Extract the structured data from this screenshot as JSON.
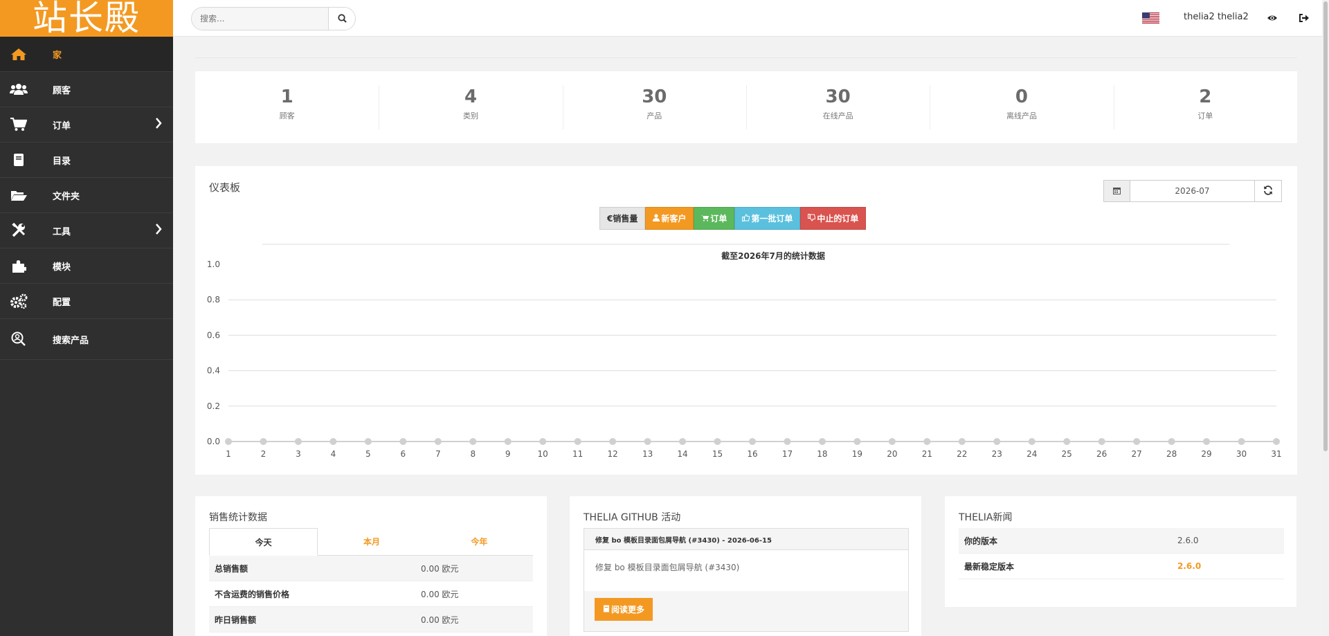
{
  "logo": {
    "text": "站长殿"
  },
  "nav": [
    {
      "label": "家",
      "icon": "home-icon",
      "active": true
    },
    {
      "label": "顾客",
      "icon": "users-icon"
    },
    {
      "label": "订单",
      "icon": "cart-icon",
      "has_submenu": true
    },
    {
      "label": "目录",
      "icon": "book-icon"
    },
    {
      "label": "文件夹",
      "icon": "folder-icon"
    },
    {
      "label": "工具",
      "icon": "tools-icon",
      "has_submenu": true
    },
    {
      "label": "模块",
      "icon": "puzzle-icon"
    },
    {
      "label": "配置",
      "icon": "gears-icon"
    },
    {
      "label": "搜索产品",
      "icon": "search-product-icon"
    }
  ],
  "topbar": {
    "search_placeholder": "搜索...",
    "username": "thelia2 thelia2"
  },
  "stats": [
    {
      "value": "1",
      "label": "顾客"
    },
    {
      "value": "4",
      "label": "类别"
    },
    {
      "value": "30",
      "label": "产品"
    },
    {
      "value": "30",
      "label": "在线产品"
    },
    {
      "value": "0",
      "label": "离线产品"
    },
    {
      "value": "2",
      "label": "订单"
    }
  ],
  "dashboard": {
    "title": "仪表板",
    "date": "2026-07",
    "buttons": [
      {
        "label": "€销售量",
        "color": "#e6e6e6",
        "text_color": "#333"
      },
      {
        "label": "新客户",
        "color": "#f39922",
        "text_color": "#fff"
      },
      {
        "label": "订单",
        "color": "#5cb85c",
        "text_color": "#fff"
      },
      {
        "label": "第一批订单",
        "color": "#5bc0de",
        "text_color": "#fff"
      },
      {
        "label": "中止的订单",
        "color": "#d9534f",
        "text_color": "#fff"
      }
    ]
  },
  "chart_data": {
    "type": "line",
    "title": "截至2026年7月的统计数据",
    "xlabel": "",
    "ylabel": "",
    "x": [
      1,
      2,
      3,
      4,
      5,
      6,
      7,
      8,
      9,
      10,
      11,
      12,
      13,
      14,
      15,
      16,
      17,
      18,
      19,
      20,
      21,
      22,
      23,
      24,
      25,
      26,
      27,
      28,
      29,
      30,
      31
    ],
    "yticks": [
      "0.0",
      "0.2",
      "0.4",
      "0.6",
      "0.8",
      "1.0"
    ],
    "ylim": [
      0,
      1
    ],
    "series": [
      {
        "values": [
          0,
          0,
          0,
          0,
          0,
          0,
          0,
          0,
          0,
          0,
          0,
          0,
          0,
          0,
          0,
          0,
          0,
          0,
          0,
          0,
          0,
          0,
          0,
          0,
          0,
          0,
          0,
          0,
          0,
          0,
          0
        ],
        "color": "#d0d0d0"
      }
    ],
    "grid": true
  },
  "sales": {
    "title": "销售统计数据",
    "tabs": [
      "今天",
      "本月",
      "今年"
    ],
    "rows": [
      {
        "label": "总销售额",
        "value": "0.00 欧元"
      },
      {
        "label": "不含运费的销售价格",
        "value": "0.00 欧元"
      },
      {
        "label": "昨日销售额",
        "value": "0.00 欧元"
      }
    ]
  },
  "github": {
    "title": "THELIA GITHUB 活动",
    "item_heading": "修复 bo 模板目录面包屑导航 (#3430) - 2026-06-15",
    "item_body": "修复 bo 模板目录面包屑导航 (#3430)",
    "read_more": "阅读更多"
  },
  "news": {
    "title": "THELIA新闻",
    "rows": [
      {
        "label": "你的版本",
        "value": "2.6.0"
      },
      {
        "label": "最新稳定版本",
        "value": "2.6.0"
      }
    ]
  },
  "colors": {
    "accent": "#f39922",
    "sidebar": "#2f2f2f"
  }
}
